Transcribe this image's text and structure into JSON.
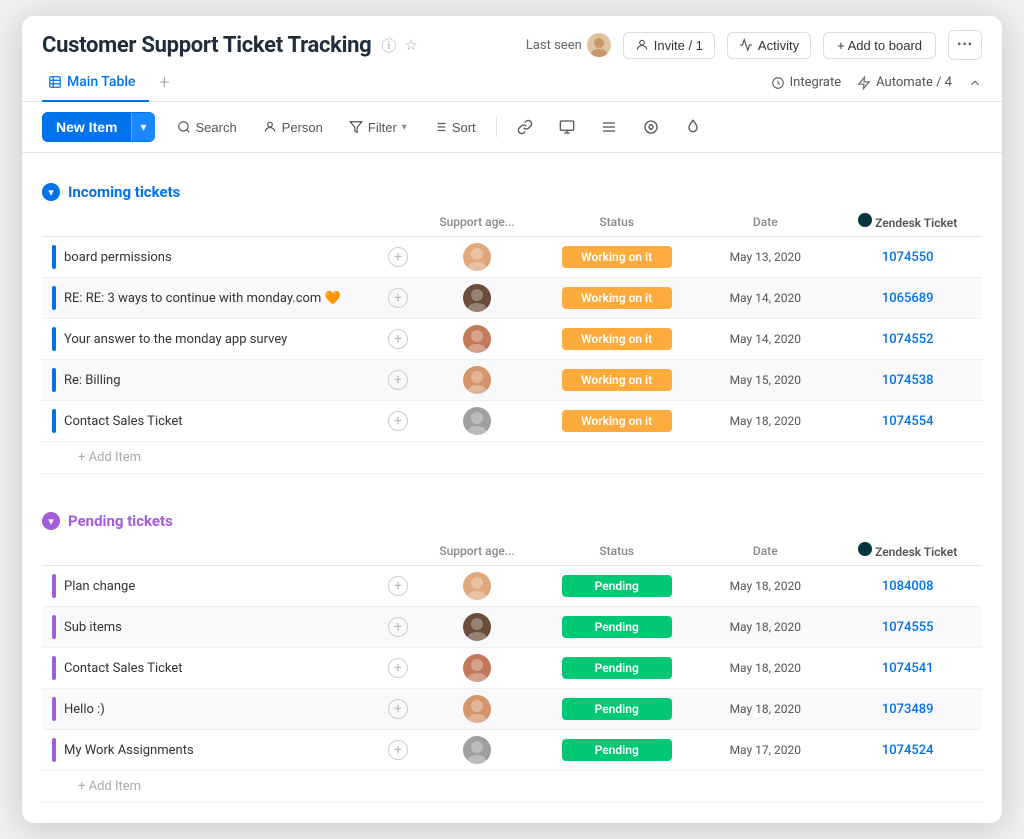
{
  "header": {
    "title": "Customer Support Ticket Tracking",
    "last_seen_label": "Last seen",
    "invite_label": "Invite / 1",
    "activity_label": "Activity",
    "add_board_label": "+ Add to board",
    "more_label": "..."
  },
  "tabs": {
    "main_table_label": "Main Table",
    "add_tab_label": "+",
    "integrate_label": "Integrate",
    "automate_label": "Automate / 4"
  },
  "toolbar": {
    "new_item_label": "New Item",
    "search_label": "Search",
    "person_label": "Person",
    "filter_label": "Filter",
    "sort_label": "Sort",
    "more_options": "..."
  },
  "sections": {
    "incoming": {
      "title": "Incoming tickets",
      "columns": {
        "name": "",
        "agent": "Support age...",
        "status": "Status",
        "date": "Date",
        "zendesk": "Zendesk Ticket"
      },
      "rows": [
        {
          "name": "board permissions",
          "agent_color": "#e0a87c",
          "agent_initials": "",
          "status": "Working on it",
          "date": "May 13, 2020",
          "zendesk": "1074550"
        },
        {
          "name": "RE: RE: 3 ways to continue with monday.com 🧡",
          "agent_color": "#6b4c3b",
          "agent_initials": "",
          "status": "Working on it",
          "date": "May 14, 2020",
          "zendesk": "1065689"
        },
        {
          "name": "Your answer to the monday app survey",
          "agent_color": "#c47a5a",
          "agent_initials": "",
          "status": "Working on it",
          "date": "May 14, 2020",
          "zendesk": "1074552"
        },
        {
          "name": "Re: Billing",
          "agent_color": "#d4956a",
          "agent_initials": "",
          "status": "Working on it",
          "date": "May 15, 2020",
          "zendesk": "1074538"
        },
        {
          "name": "Contact Sales Ticket",
          "agent_color": "#a0a0a0",
          "agent_initials": "",
          "status": "Working on it",
          "date": "May 18, 2020",
          "zendesk": "1074554"
        }
      ],
      "add_item_label": "+ Add Item"
    },
    "pending": {
      "title": "Pending tickets",
      "columns": {
        "name": "",
        "agent": "Support age...",
        "status": "Status",
        "date": "Date",
        "zendesk": "Zendesk Ticket"
      },
      "rows": [
        {
          "name": "Plan change",
          "agent_color": "#c47a5a",
          "agent_initials": "",
          "status": "Pending",
          "date": "May 18, 2020",
          "zendesk": "1084008"
        },
        {
          "name": "Sub items",
          "agent_color": "#d4956a",
          "agent_initials": "",
          "status": "Pending",
          "date": "May 18, 2020",
          "zendesk": "1074555"
        },
        {
          "name": "Contact Sales Ticket",
          "agent_color": "#7a5c4a",
          "agent_initials": "",
          "status": "Pending",
          "date": "May 18, 2020",
          "zendesk": "1074541"
        },
        {
          "name": "Hello :)",
          "agent_color": "#e0c4a0",
          "agent_initials": "",
          "status": "Pending",
          "date": "May 18, 2020",
          "zendesk": "1073489"
        },
        {
          "name": "My Work Assignments",
          "agent_color": "#e0c4a0",
          "agent_initials": "",
          "status": "Pending",
          "date": "May 17, 2020",
          "zendesk": "1074524"
        }
      ],
      "add_item_label": "+ Add Item"
    }
  },
  "colors": {
    "accent_blue": "#0073ea",
    "accent_purple": "#a25ddc",
    "status_working": "#fdab3d",
    "status_pending": "#00c875"
  }
}
